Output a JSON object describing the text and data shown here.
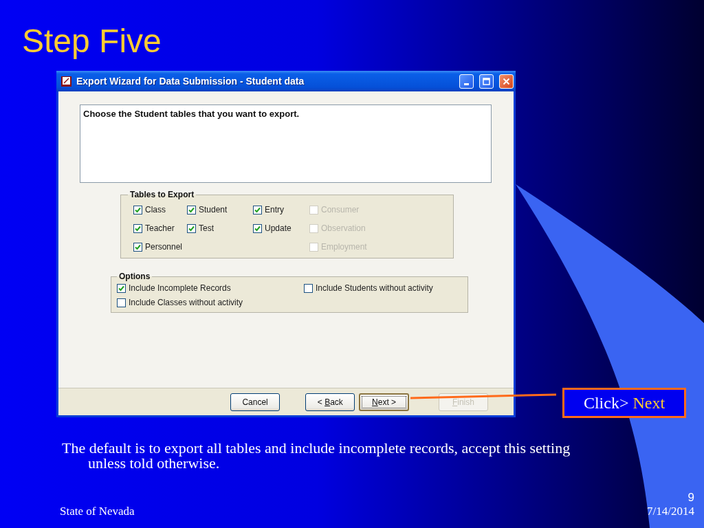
{
  "slide": {
    "title": "Step Five"
  },
  "window": {
    "title": "Export Wizard for Data Submission - Student data",
    "instruction": "Choose the Student tables that you want to export.",
    "tables_group": {
      "label": "Tables to Export",
      "columns": [
        [
          {
            "label": "Class",
            "checked": true,
            "disabled": false
          },
          {
            "label": "Teacher",
            "checked": true,
            "disabled": false
          },
          {
            "label": "Personnel",
            "checked": true,
            "disabled": false
          }
        ],
        [
          {
            "label": "Student",
            "checked": true,
            "disabled": false
          },
          {
            "label": "Test",
            "checked": true,
            "disabled": false
          }
        ],
        [
          {
            "label": "Entry",
            "checked": true,
            "disabled": false
          },
          {
            "label": "Update",
            "checked": true,
            "disabled": false
          }
        ],
        [
          {
            "label": "Consumer",
            "checked": false,
            "disabled": true
          },
          {
            "label": "Observation",
            "checked": false,
            "disabled": true
          },
          {
            "label": "Employment",
            "checked": false,
            "disabled": true
          }
        ]
      ]
    },
    "options_group": {
      "label": "Options",
      "items": [
        {
          "label": "Include Incomplete Records",
          "checked": true
        },
        {
          "label": "Include Students without activity",
          "checked": false
        },
        {
          "label": "Include Classes without activity",
          "checked": false
        }
      ]
    },
    "buttons": [
      {
        "prefix": "Cancel",
        "default": false,
        "disabled": false
      },
      {
        "prefix": "< ",
        "key": "B",
        "suffix": "ack",
        "default": false,
        "disabled": false
      },
      {
        "key": "N",
        "suffix": "ext >",
        "default": true,
        "disabled": false
      },
      {
        "key": "F",
        "suffix": "inish",
        "default": false,
        "disabled": true
      }
    ]
  },
  "callout": {
    "prefix": "Click>",
    "highlight": "Next"
  },
  "note": "The default is to export all tables and include incomplete records, accept this setting unless told otherwise.",
  "footer": {
    "left": "State of Nevada",
    "page": "9",
    "date": "7/14/2014"
  }
}
